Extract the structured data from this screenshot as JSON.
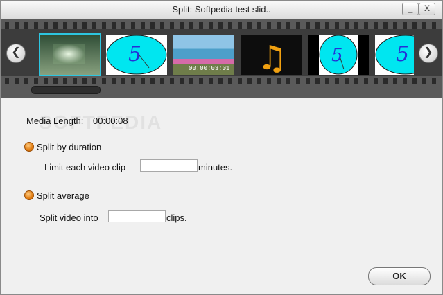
{
  "window": {
    "title": "Split: Softpedia test slid..",
    "minimize_label": "_",
    "close_label": "X"
  },
  "filmstrip": {
    "left_arrow": "❮",
    "right_arrow": "❯",
    "thumbs": [
      {
        "kind": "video",
        "glyph": ""
      },
      {
        "kind": "image",
        "glyph": "5"
      },
      {
        "kind": "video",
        "glyph": "",
        "timestamp": "00:00:03;01"
      },
      {
        "kind": "audio",
        "glyph": "♫"
      },
      {
        "kind": "image",
        "glyph": "5"
      },
      {
        "kind": "image",
        "glyph": "5"
      }
    ],
    "colors": {
      "selected_border": "#2dc5e0",
      "disc": "#00e6f0",
      "glyph": "#2430d8",
      "note": "#f0a010"
    }
  },
  "watermark": "SOFTPEDIA",
  "media": {
    "length_label": "Media Length:",
    "length_value": "00:00:08"
  },
  "options": {
    "duration": {
      "label": "Split by duration",
      "prefix": "Limit each video clip",
      "value": "",
      "suffix": "minutes."
    },
    "average": {
      "label": "Split average",
      "prefix": "Split video into",
      "value": "",
      "suffix": "clips."
    }
  },
  "ok_label": "OK"
}
